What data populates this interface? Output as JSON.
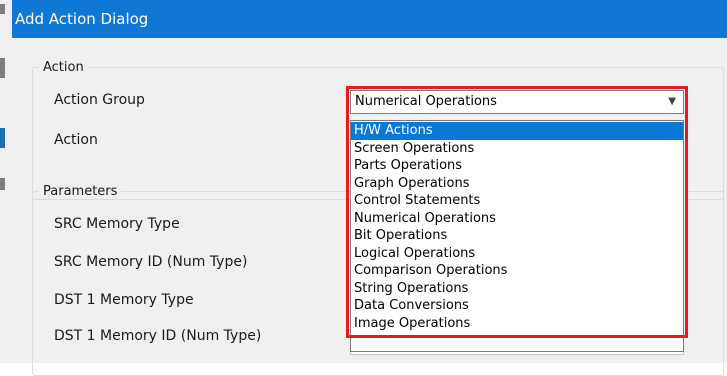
{
  "dialog": {
    "title": "Add Action Dialog"
  },
  "action_section": {
    "legend": "Action",
    "action_group_label": "Action Group",
    "action_label": "Action",
    "action_group_selected": "Numerical Operations"
  },
  "dropdown": {
    "options": [
      "H/W Actions",
      "Screen Operations",
      "Parts Operations",
      "Graph Operations",
      "Control Statements",
      "Numerical Operations",
      "Bit Operations",
      "Logical Operations",
      "Comparison Operations",
      "String Operations",
      "Data Conversions",
      "Image Operations"
    ],
    "highlighted_index": 0
  },
  "parameters_section": {
    "legend": "Parameters",
    "fields": [
      "SRC Memory Type",
      "SRC Memory ID (Num Type)",
      "DST 1 Memory Type",
      "DST 1 Memory ID (Num Type)"
    ]
  },
  "colors": {
    "titlebar": "#0f77d4",
    "selection": "#0a78d7",
    "annotation": "#e31b23",
    "dialog_bg": "#f0f0f0"
  },
  "icons": {
    "combo_arrow": "chevron-down-icon"
  }
}
